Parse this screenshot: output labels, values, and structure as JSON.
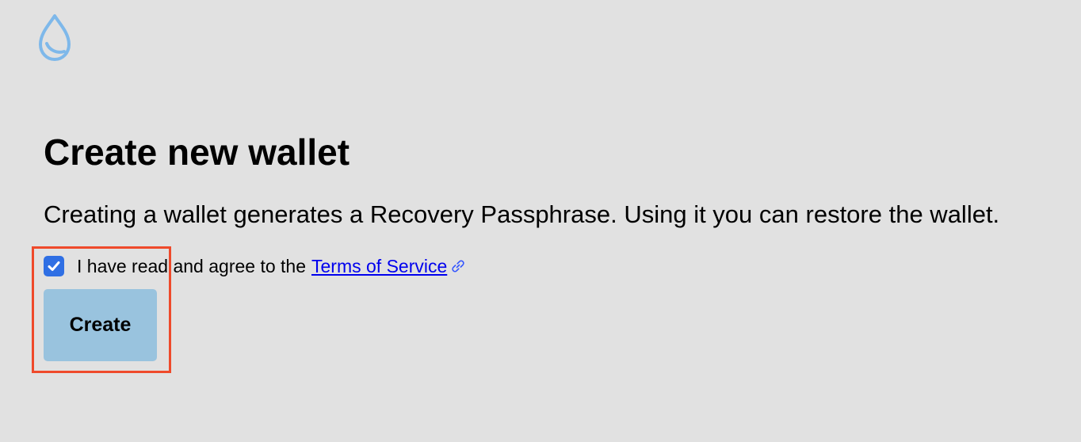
{
  "logo": {
    "icon": "water-drop-icon",
    "color": "#7eb8ea"
  },
  "heading": "Create new wallet",
  "description": "Creating a wallet generates a Recovery Passphrase. Using it you can restore the wallet.",
  "terms": {
    "checked": true,
    "label": "I have read and agree to the",
    "link_text": "Terms of Service",
    "link_icon": "external-link-icon"
  },
  "create_button": {
    "label": "Create",
    "background": "#99c3de"
  },
  "highlight_color": "#ef4a2b",
  "accent_color": "#2f6fe4"
}
